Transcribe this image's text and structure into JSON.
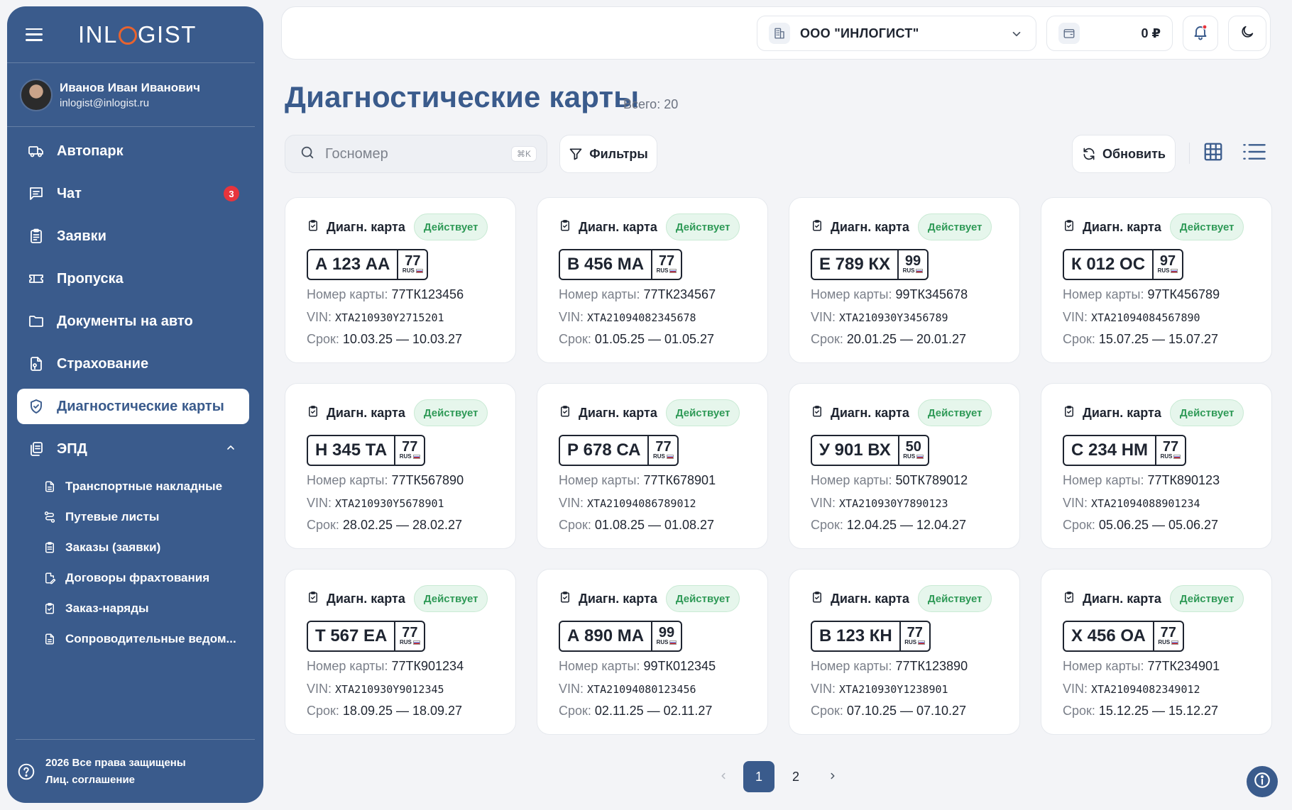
{
  "app": {
    "logo": "INLOGIST",
    "brand_color": "#3a5b8c",
    "accent_color": "#e8632f"
  },
  "user": {
    "name": "Иванов Иван Иванович",
    "email": "inlogist@inlogist.ru"
  },
  "sidebar": {
    "items": [
      {
        "label": "Автопарк",
        "icon": "truck-icon"
      },
      {
        "label": "Чат",
        "icon": "chat-icon",
        "badge": "3"
      },
      {
        "label": "Заявки",
        "icon": "clipboard-icon"
      },
      {
        "label": "Пропуска",
        "icon": "ticket-icon"
      },
      {
        "label": "Документы на авто",
        "icon": "folder-icon"
      },
      {
        "label": "Страхование",
        "icon": "insurance-icon"
      },
      {
        "label": "Диагностические карты",
        "icon": "shield-check-icon",
        "active": true
      },
      {
        "label": "ЭПД",
        "icon": "documents-icon",
        "expanded": true
      }
    ],
    "sub_items": [
      {
        "label": "Транспортные накладные",
        "icon": "doc-icon"
      },
      {
        "label": "Путевые листы",
        "icon": "route-icon"
      },
      {
        "label": "Заказы (заявки)",
        "icon": "clipboard-icon"
      },
      {
        "label": "Договоры фрахтования",
        "icon": "contract-icon"
      },
      {
        "label": "Заказ-наряды",
        "icon": "clipboard-check-icon"
      },
      {
        "label": "Сопроводительные ведом...",
        "icon": "doc-icon"
      }
    ],
    "footer": {
      "copyright": "2026 Все права защищены",
      "agreement": "Лиц. соглашение"
    }
  },
  "topbar": {
    "company": "ООО \"ИНЛОГИСТ\"",
    "balance": "0 ₽",
    "has_notification": true
  },
  "page": {
    "title": "Диагностические карты",
    "total": "Всего: 20"
  },
  "toolbar": {
    "search_placeholder": "Госномер",
    "search_shortcut": "⌘K",
    "filters_label": "Фильтры",
    "refresh_label": "Обновить",
    "view": "grid"
  },
  "cards_common": {
    "title": "Диагн. карта",
    "card_no_label": "Номер карты:",
    "vin_label": "VIN:",
    "term_label": "Срок:",
    "plate_country": "RUS",
    "status_color": "#2f9a57"
  },
  "cards": [
    {
      "plate": "А 123 АА",
      "region": "77",
      "status": "Действует",
      "card_no": "77ТК123456",
      "vin": "XTA210930Y2715201",
      "term": "10.03.25 — 10.03.27"
    },
    {
      "plate": "В 456 МА",
      "region": "77",
      "status": "Действует",
      "card_no": "77ТК234567",
      "vin": "XTA21094082345678",
      "term": "01.05.25 — 01.05.27"
    },
    {
      "plate": "Е 789 КХ",
      "region": "99",
      "status": "Действует",
      "card_no": "99ТК345678",
      "vin": "XTA210930Y3456789",
      "term": "20.01.25 — 20.01.27"
    },
    {
      "plate": "К 012 ОС",
      "region": "97",
      "status": "Действует",
      "card_no": "97ТК456789",
      "vin": "XTA21094084567890",
      "term": "15.07.25 — 15.07.27"
    },
    {
      "plate": "Н 345 ТА",
      "region": "77",
      "status": "Действует",
      "card_no": "77ТК567890",
      "vin": "XTA210930Y5678901",
      "term": "28.02.25 — 28.02.27"
    },
    {
      "plate": "Р 678 СА",
      "region": "77",
      "status": "Действует",
      "card_no": "77ТК678901",
      "vin": "XTA21094086789012",
      "term": "01.08.25 — 01.08.27"
    },
    {
      "plate": "У 901 ВХ",
      "region": "50",
      "status": "Действует",
      "card_no": "50ТК789012",
      "vin": "XTA210930Y7890123",
      "term": "12.04.25 — 12.04.27"
    },
    {
      "plate": "С 234 НМ",
      "region": "77",
      "status": "Действует",
      "card_no": "77ТК890123",
      "vin": "XTA21094088901234",
      "term": "05.06.25 — 05.06.27"
    },
    {
      "plate": "Т 567 ЕА",
      "region": "77",
      "status": "Действует",
      "card_no": "77ТК901234",
      "vin": "XTA210930Y9012345",
      "term": "18.09.25 — 18.09.27"
    },
    {
      "plate": "А 890 МА",
      "region": "99",
      "status": "Действует",
      "card_no": "99ТК012345",
      "vin": "XTA21094080123456",
      "term": "02.11.25 — 02.11.27"
    },
    {
      "plate": "В 123 КН",
      "region": "77",
      "status": "Действует",
      "card_no": "77ТК123890",
      "vin": "XTA210930Y1238901",
      "term": "07.10.25 — 07.10.27"
    },
    {
      "plate": "Х 456 ОА",
      "region": "77",
      "status": "Действует",
      "card_no": "77ТК234901",
      "vin": "XTA21094082349012",
      "term": "15.12.25 — 15.12.27"
    }
  ],
  "pagination": {
    "pages": [
      "1",
      "2"
    ],
    "current": "1"
  }
}
